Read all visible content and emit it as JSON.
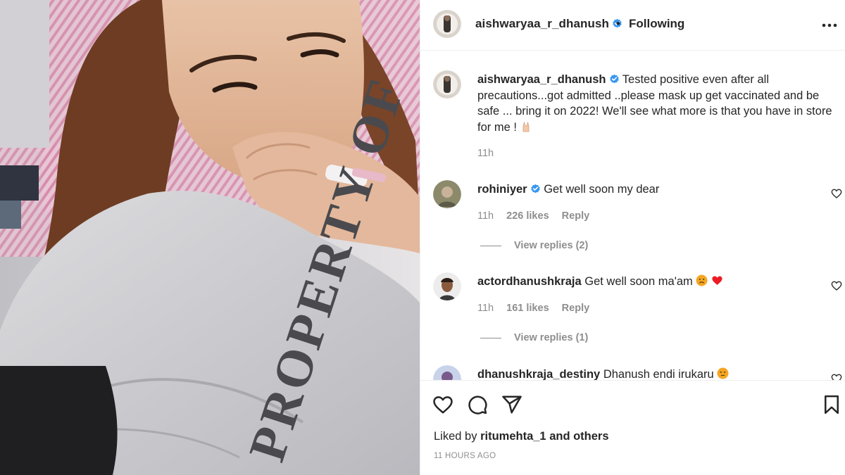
{
  "post": {
    "username": "aishwaryaa_r_dhanush",
    "separator": "•",
    "follow_status": "Following",
    "caption": "Tested positive even after all precautions...got admitted ..please mask up get vaccinated and be safe ... bring it on 2022! We'll see what more is that you have in store for me !",
    "caption_time": "11h",
    "liked_by_prefix": "Liked by",
    "liked_by_user": "ritumehta_1",
    "liked_by_suffix": "and others",
    "time_ago": "11 HOURS AGO"
  },
  "photo": {
    "shirt_text": "PROPERTY OF"
  },
  "comments": [
    {
      "username": "rohiniyer",
      "verified": true,
      "text": "Get well soon my dear",
      "time": "11h",
      "likes": "226 likes",
      "reply": "Reply",
      "view_replies": "View replies (2)"
    },
    {
      "username": "actordhanushkraja",
      "verified": false,
      "text": "Get well soon ma'am",
      "time": "11h",
      "likes": "161 likes",
      "reply": "Reply",
      "view_replies": "View replies (1)"
    },
    {
      "username": "dhanushkraja_destiny",
      "verified": false,
      "text": "Dhanush endi irukaru"
    }
  ],
  "icons": {
    "like": "heart-icon",
    "comment": "comment-bubble-icon",
    "share": "paper-plane-icon",
    "save": "bookmark-icon",
    "more": "more-options-icon",
    "verified": "verified-badge-icon"
  },
  "colors": {
    "verified_blue": "#3897f0",
    "muted_text": "#8e8e8e",
    "primary_text": "#262626",
    "heart_red": "#ed1c24"
  }
}
